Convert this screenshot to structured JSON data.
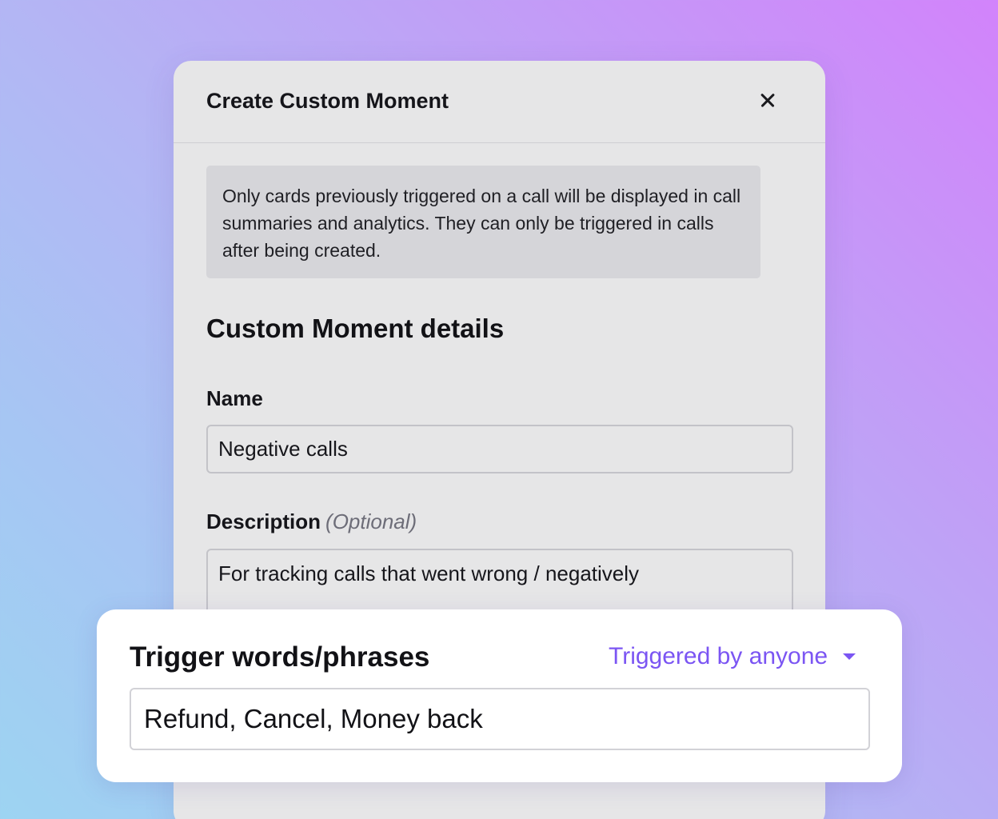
{
  "modal": {
    "title": "Create Custom Moment",
    "close_label": "×",
    "notice": "Only cards previously triggered on a call will be displayed in call summaries and analytics. They can only be triggered in calls after being created.",
    "section_title": "Custom Moment details",
    "name_label": "Name",
    "name_value": "Negative calls",
    "description_label": "Description",
    "description_optional": "(Optional)",
    "description_value": "For tracking calls that went wrong / negatively"
  },
  "trigger": {
    "title": "Trigger words/phrases",
    "selected_option": "Triggered by anyone",
    "value": "Refund, Cancel, Money back"
  },
  "colors": {
    "accent": "#7b55f3",
    "modal_bg": "#e6e6e7",
    "notice_bg": "#d5d5d9"
  },
  "icons": {
    "close": "close-icon",
    "dropdown": "chevron-down-icon"
  }
}
